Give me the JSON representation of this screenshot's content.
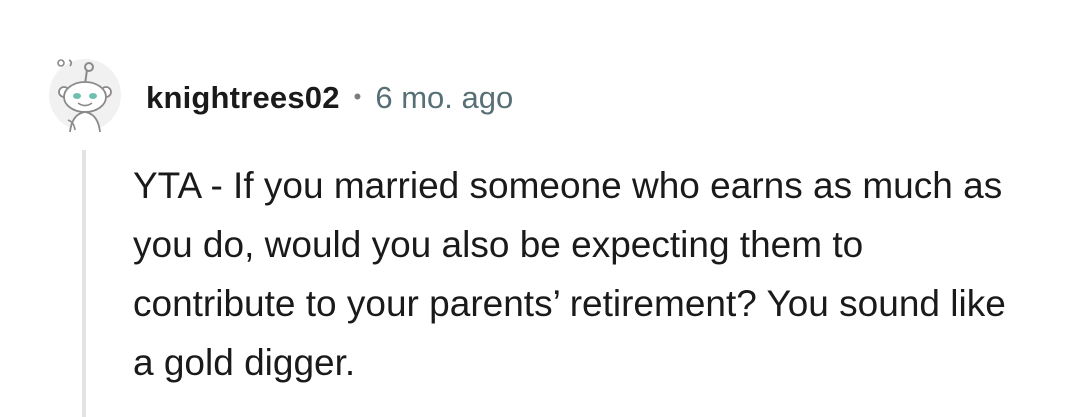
{
  "comment": {
    "author": "knightrees02",
    "separator": "•",
    "timestamp": "6 mo. ago",
    "body": "YTA - If you married someone who earns as much as you do, would you also be expecting them to contribute to your parents’ retirement? You sound like a gold digger.",
    "avatar_icon": "snoo-avatar-icon"
  }
}
